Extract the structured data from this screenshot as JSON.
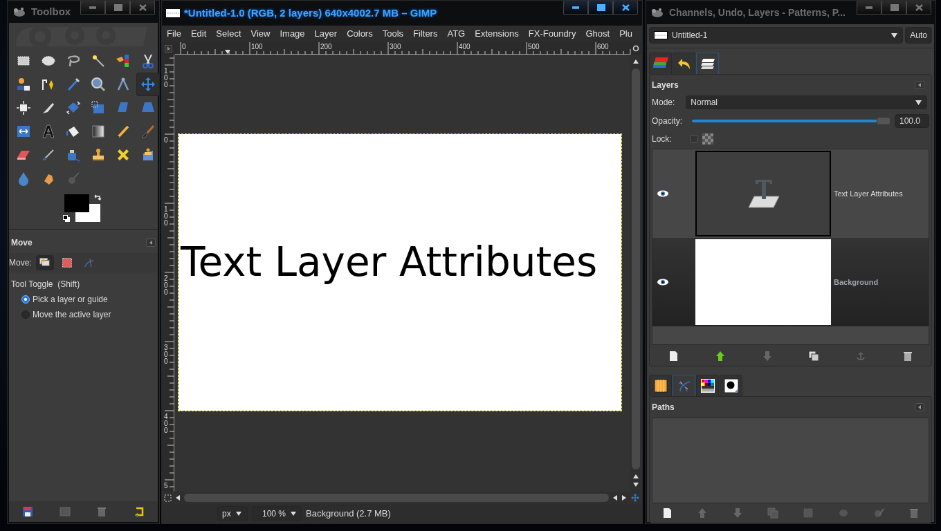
{
  "toolbox": {
    "title": "Toolbox",
    "tools": [
      {
        "kind": "rectangle",
        "selected": false
      },
      {
        "kind": "ellipse",
        "selected": false
      },
      {
        "kind": "lasso",
        "selected": false
      },
      {
        "kind": "wand",
        "selected": false
      },
      {
        "kind": "squares",
        "selected": false
      },
      {
        "kind": "scissors",
        "selected": false
      },
      {
        "kind": "person",
        "selected": false
      },
      {
        "kind": "pen",
        "selected": false
      },
      {
        "kind": "eyedropper",
        "selected": false
      },
      {
        "kind": "magnifier",
        "selected": false
      },
      {
        "kind": "compass",
        "selected": false
      },
      {
        "kind": "move",
        "selected": true
      },
      {
        "kind": "align",
        "selected": false
      },
      {
        "kind": "knife",
        "selected": false
      },
      {
        "kind": "rotate",
        "selected": false
      },
      {
        "kind": "scale",
        "selected": false
      },
      {
        "kind": "shear",
        "selected": false
      },
      {
        "kind": "trapezoid",
        "selected": false
      },
      {
        "kind": "flip",
        "selected": false
      },
      {
        "kind": "text",
        "selected": false
      },
      {
        "kind": "bucket",
        "selected": false
      },
      {
        "kind": "gradient",
        "selected": false
      },
      {
        "kind": "pencil",
        "selected": false
      },
      {
        "kind": "brush",
        "selected": false
      },
      {
        "kind": "eraser",
        "selected": false
      },
      {
        "kind": "airbrush",
        "selected": false
      },
      {
        "kind": "ink",
        "selected": false
      },
      {
        "kind": "stamp",
        "selected": false
      },
      {
        "kind": "bandage",
        "selected": false
      },
      {
        "kind": "stamp-page",
        "selected": false
      },
      {
        "kind": "drop",
        "selected": false
      },
      {
        "kind": "hand",
        "selected": false
      },
      {
        "kind": "dodge",
        "selected": false
      }
    ],
    "foreground": {
      "color": "#000000"
    },
    "background": {
      "color": "#ffffff"
    },
    "tool_options": {
      "title": "Move",
      "move_label": "Move:",
      "move_modes": [
        {
          "kind": "layer",
          "selected": true
        },
        {
          "kind": "selection",
          "selected": false
        },
        {
          "kind": "path",
          "selected": false
        }
      ],
      "toggle_label": "Tool Toggle  (Shift)",
      "radios": [
        {
          "label": "Pick a layer or guide",
          "selected": true
        },
        {
          "label": "Move the active layer",
          "selected": false
        }
      ]
    }
  },
  "image_window": {
    "title": "*Untitled-1.0 (RGB, 2 layers) 640x4002.7 MB – GIMP",
    "menu": [
      {
        "label": "File"
      },
      {
        "label": "Edit"
      },
      {
        "label": "Select"
      },
      {
        "label": "View"
      },
      {
        "label": "Image"
      },
      {
        "label": "Layer"
      },
      {
        "label": "Colors"
      },
      {
        "label": "Tools"
      },
      {
        "label": "Filters"
      },
      {
        "label": "ATG"
      },
      {
        "label": "Extensions"
      },
      {
        "label": "FX-Foundry"
      },
      {
        "label": "Ghost"
      },
      {
        "label": "Plu"
      }
    ],
    "h_ruler": [
      {
        "label": "0"
      },
      {
        "label": "100"
      },
      {
        "label": "200"
      },
      {
        "label": "300"
      },
      {
        "label": "400"
      },
      {
        "label": "500"
      },
      {
        "label": "600"
      }
    ],
    "v_ruler": [
      {
        "label": "100"
      },
      {
        "label": "0"
      },
      {
        "label": "100"
      },
      {
        "label": "200"
      },
      {
        "label": "300"
      },
      {
        "label": "400"
      },
      {
        "label": "5"
      }
    ],
    "canvas_text": "Text Layer Attributes",
    "status": {
      "unit": "px",
      "zoom": "100 %",
      "info": "Background (2.7 MB)"
    }
  },
  "dock": {
    "title": "Channels, Undo, Layers - Patterns, P...",
    "image": "Untitled-1",
    "auto": "Auto",
    "tabs": [
      {
        "kind": "channels",
        "selected": false
      },
      {
        "kind": "undo",
        "selected": false
      },
      {
        "kind": "layers",
        "selected": true
      }
    ],
    "layers_panel": {
      "title": "Layers",
      "mode_label": "Mode:",
      "mode": "Normal",
      "opacity_label": "Opacity:",
      "opacity": {
        "level": 1.0,
        "reading": "100.0"
      },
      "lock_label": "Lock:",
      "lock": {
        "checked": false
      },
      "layers": [
        {
          "name": "Text Layer Attributes",
          "kind": "text",
          "visible": true,
          "selected": false
        },
        {
          "name": "Background",
          "kind": "image",
          "visible": true,
          "selected": true
        }
      ]
    },
    "tabs2": [
      {
        "kind": "pattern",
        "selected": false
      },
      {
        "kind": "paths",
        "selected": true
      },
      {
        "kind": "palette",
        "selected": false
      },
      {
        "kind": "brush-dot",
        "selected": false
      }
    ],
    "paths_panel": {
      "title": "Paths"
    }
  }
}
